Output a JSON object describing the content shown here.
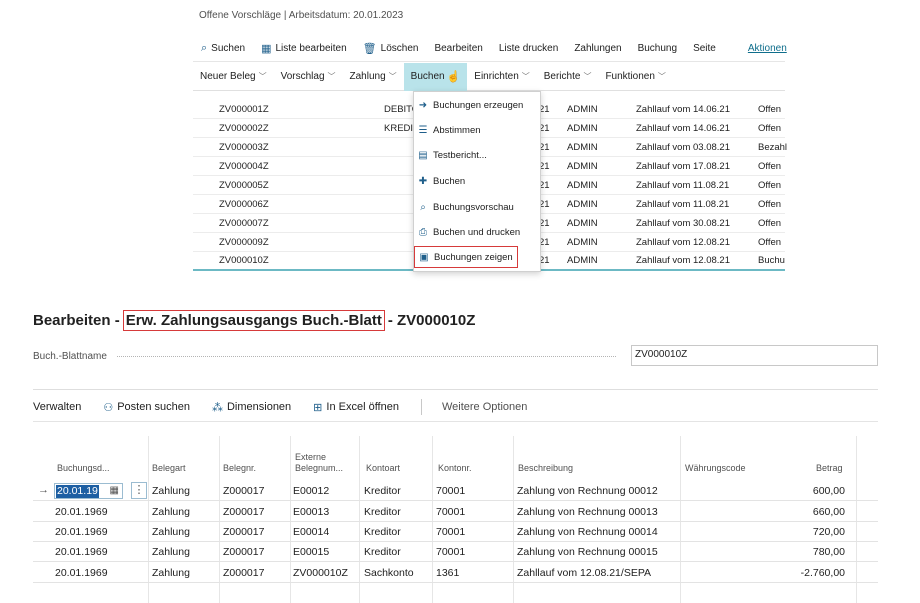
{
  "top": {
    "subtitle": "Offene Vorschläge | Arbeitsdatum: 20.01.2023",
    "commands": [
      {
        "label": "Suchen",
        "icon": "search-icon"
      },
      {
        "label": "Liste bearbeiten",
        "icon": "edit-list-icon"
      },
      {
        "label": "Löschen",
        "icon": "trash-icon"
      },
      {
        "label": "Bearbeiten"
      },
      {
        "label": "Liste drucken"
      },
      {
        "label": "Zahlungen"
      },
      {
        "label": "Buchung"
      },
      {
        "label": "Seite"
      },
      {
        "label": "Aktionen"
      }
    ],
    "ribbon": [
      "Neuer Beleg",
      "Vorschlag",
      "Zahlung",
      "Buchen",
      "Einrichten",
      "Berichte",
      "Funktionen"
    ],
    "rows": [
      {
        "no": "ZV000001Z",
        "type": "DEBITO",
        "day": "21",
        "user": "ADMIN",
        "desc": "Zahllauf vom 14.06.21",
        "status": "Offen"
      },
      {
        "no": "ZV000002Z",
        "type": "KREDIT",
        "day": "21",
        "user": "ADMIN",
        "desc": "Zahllauf vom 14.06.21",
        "status": "Offen"
      },
      {
        "no": "ZV000003Z",
        "type": "",
        "day": "21",
        "user": "ADMIN",
        "desc": "Zahllauf vom 03.08.21",
        "status": "Bezahl"
      },
      {
        "no": "ZV000004Z",
        "type": "",
        "day": "21",
        "user": "ADMIN",
        "desc": "Zahllauf vom 17.08.21",
        "status": "Offen"
      },
      {
        "no": "ZV000005Z",
        "type": "",
        "day": "21",
        "user": "ADMIN",
        "desc": "Zahllauf vom 11.08.21",
        "status": "Offen"
      },
      {
        "no": "ZV000006Z",
        "type": "",
        "day": "21",
        "user": "ADMIN",
        "desc": "Zahllauf vom 11.08.21",
        "status": "Offen"
      },
      {
        "no": "ZV000007Z",
        "type": "",
        "day": "21",
        "user": "ADMIN",
        "desc": "Zahllauf vom 30.08.21",
        "status": "Offen"
      },
      {
        "no": "ZV000009Z",
        "type": "",
        "day": "21",
        "user": "ADMIN",
        "desc": "Zahllauf vom 12.08.21",
        "status": "Offen"
      },
      {
        "no": "ZV000010Z",
        "type": "",
        "day": "21",
        "user": "ADMIN",
        "desc": "Zahllauf vom 12.08.21",
        "status": "Buchu"
      }
    ],
    "dropdown": [
      {
        "label": "Buchungen erzeugen",
        "icon": "arrow-right-icon"
      },
      {
        "label": "Abstimmen",
        "icon": "reconcile-icon"
      },
      {
        "label": "Testbericht...",
        "icon": "report-icon"
      },
      {
        "label": "Buchen",
        "icon": "post-icon"
      },
      {
        "label": "Buchungsvorschau",
        "icon": "preview-icon"
      },
      {
        "label": "Buchen und drucken",
        "icon": "print-icon"
      },
      {
        "label": "Buchungen zeigen",
        "icon": "ledger-icon"
      }
    ]
  },
  "edit": {
    "title_prefix": "Bearbeiten -",
    "title_boxed": "Erw. Zahlungsausgangs Buch.-Blatt",
    "title_suffix": "- ZV000010Z",
    "field_label": "Buch.-Blattname",
    "field_value": "ZV000010Z",
    "actions": [
      {
        "label": "Verwalten"
      },
      {
        "label": "Posten suchen",
        "icon": "binoculars-icon"
      },
      {
        "label": "Dimensionen",
        "icon": "dimensions-icon"
      },
      {
        "label": "In Excel öffnen",
        "icon": "excel-icon"
      },
      {
        "label": "Weitere Optionen"
      }
    ],
    "columns": {
      "date": "Buchungsd...",
      "doctype": "Belegart",
      "docno": "Belegnr.",
      "extdoc_1": "Externe",
      "extdoc_2": "Belegnum...",
      "acctype": "Kontoart",
      "accno": "Kontonr.",
      "desc": "Beschreibung",
      "currency": "Währungscode",
      "amount": "Betrag"
    },
    "rows": [
      {
        "date": "20.01.19",
        "doctype": "Zahlung",
        "docno": "Z000017",
        "extdoc": "E00012",
        "acctype": "Kreditor",
        "accno": "70001",
        "desc": "Zahlung von Rechnung 00012",
        "currency": "",
        "amount": "600,00"
      },
      {
        "date": "20.01.1969",
        "doctype": "Zahlung",
        "docno": "Z000017",
        "extdoc": "E00013",
        "acctype": "Kreditor",
        "accno": "70001",
        "desc": "Zahlung von Rechnung 00013",
        "currency": "",
        "amount": "660,00"
      },
      {
        "date": "20.01.1969",
        "doctype": "Zahlung",
        "docno": "Z000017",
        "extdoc": "E00014",
        "acctype": "Kreditor",
        "accno": "70001",
        "desc": "Zahlung von Rechnung 00014",
        "currency": "",
        "amount": "720,00"
      },
      {
        "date": "20.01.1969",
        "doctype": "Zahlung",
        "docno": "Z000017",
        "extdoc": "E00015",
        "acctype": "Kreditor",
        "accno": "70001",
        "desc": "Zahlung von Rechnung 00015",
        "currency": "",
        "amount": "780,00"
      },
      {
        "date": "20.01.1969",
        "doctype": "Zahlung",
        "docno": "Z000017",
        "extdoc": "ZV000010Z",
        "acctype": "Sachkonto",
        "accno": "1361",
        "desc": "Zahllauf vom 12.08.21/SEPA",
        "currency": "",
        "amount": "-2.760,00"
      }
    ]
  },
  "colors": {
    "accent": "#0f6e8c",
    "highlight": "#d63a3a",
    "selection": "#1d5fa3",
    "ribbon_open": "#b9e3ea"
  }
}
